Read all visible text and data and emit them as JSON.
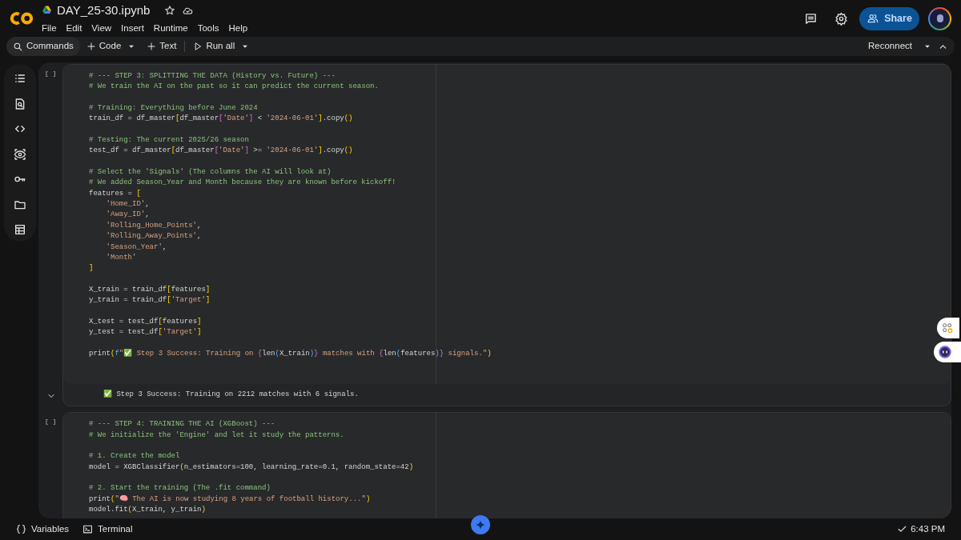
{
  "header": {
    "file_name": "DAY_25-30.ipynb",
    "menu": [
      "File",
      "Edit",
      "View",
      "Insert",
      "Runtime",
      "Tools",
      "Help"
    ],
    "share_label": "Share"
  },
  "toolbar": {
    "commands": "Commands",
    "add_code": "Code",
    "add_text": "Text",
    "run_all": "Run all",
    "connection": "Reconnect"
  },
  "cells": [
    {
      "run_label": "[ ]",
      "blocks": [
        [
          [
            {
              "kind": "comment",
              "text": "# --- STEP 3: SPLITTING THE DATA (History vs. Future) ---"
            }
          ],
          [
            {
              "kind": "comment",
              "text": "# We train the AI on the past so it can predict the current season."
            }
          ]
        ],
        [
          [
            {
              "kind": "comment",
              "text": "# Training: Everything before June 2024"
            }
          ],
          [
            {
              "kind": "plain",
              "text": "train_df = df_master"
            },
            {
              "kind": "bracket",
              "text": "["
            },
            {
              "kind": "plain",
              "text": "df_master"
            },
            {
              "kind": "brace",
              "text": "["
            },
            {
              "kind": "string",
              "text": "'Date'"
            },
            {
              "kind": "brace",
              "text": "]"
            },
            {
              "kind": "plain",
              "text": " < "
            },
            {
              "kind": "string",
              "text": "'2024-06-01'"
            },
            {
              "kind": "bracket",
              "text": "]"
            },
            {
              "kind": "plain",
              "text": ".copy"
            },
            {
              "kind": "bracket",
              "text": "()"
            }
          ]
        ],
        [
          [
            {
              "kind": "comment",
              "text": "# Testing: The current 2025/26 season"
            }
          ],
          [
            {
              "kind": "plain",
              "text": "test_df = df_master"
            },
            {
              "kind": "bracket",
              "text": "["
            },
            {
              "kind": "plain",
              "text": "df_master"
            },
            {
              "kind": "brace",
              "text": "["
            },
            {
              "kind": "string",
              "text": "'Date'"
            },
            {
              "kind": "brace",
              "text": "]"
            },
            {
              "kind": "plain",
              "text": " >= "
            },
            {
              "kind": "string",
              "text": "'2024-06-01'"
            },
            {
              "kind": "bracket",
              "text": "]"
            },
            {
              "kind": "plain",
              "text": ".copy"
            },
            {
              "kind": "bracket",
              "text": "()"
            }
          ]
        ],
        [
          [
            {
              "kind": "comment",
              "text": "# Select the 'Signals' (The columns the AI will look at)"
            }
          ],
          [
            {
              "kind": "comment",
              "text": "# We added Season_Year and Month because they are known before kickoff!"
            }
          ],
          [
            {
              "kind": "plain",
              "text": "features = "
            },
            {
              "kind": "bracket",
              "text": "["
            }
          ],
          [
            {
              "kind": "string",
              "text": "    'Home_ID'"
            },
            {
              "kind": "plain",
              "text": ","
            }
          ],
          [
            {
              "kind": "string",
              "text": "    'Away_ID'"
            },
            {
              "kind": "plain",
              "text": ","
            }
          ],
          [
            {
              "kind": "string",
              "text": "    'Rolling_Home_Points'"
            },
            {
              "kind": "plain",
              "text": ","
            }
          ],
          [
            {
              "kind": "string",
              "text": "    'Rolling_Away_Points'"
            },
            {
              "kind": "plain",
              "text": ","
            }
          ],
          [
            {
              "kind": "string",
              "text": "    'Season_Year'"
            },
            {
              "kind": "plain",
              "text": ","
            }
          ],
          [
            {
              "kind": "string",
              "text": "    'Month'"
            }
          ],
          [
            {
              "kind": "bracket",
              "text": "]"
            }
          ]
        ],
        [
          [
            {
              "kind": "plain",
              "text": "X_train = train_df"
            },
            {
              "kind": "bracket",
              "text": "["
            },
            {
              "kind": "plain",
              "text": "features"
            },
            {
              "kind": "bracket",
              "text": "]"
            }
          ],
          [
            {
              "kind": "plain",
              "text": "y_train = train_df"
            },
            {
              "kind": "bracket",
              "text": "["
            },
            {
              "kind": "string",
              "text": "'Target'"
            },
            {
              "kind": "bracket",
              "text": "]"
            }
          ]
        ],
        [
          [
            {
              "kind": "plain",
              "text": "X_test = test_df"
            },
            {
              "kind": "bracket",
              "text": "["
            },
            {
              "kind": "plain",
              "text": "features"
            },
            {
              "kind": "bracket",
              "text": "]"
            }
          ],
          [
            {
              "kind": "plain",
              "text": "y_test = test_df"
            },
            {
              "kind": "bracket",
              "text": "["
            },
            {
              "kind": "string",
              "text": "'Target'"
            },
            {
              "kind": "bracket",
              "text": "]"
            }
          ]
        ],
        [
          [
            {
              "kind": "plain",
              "text": "print"
            },
            {
              "kind": "bracket",
              "text": "("
            },
            {
              "kind": "paren",
              "text": "f"
            },
            {
              "kind": "string",
              "text": "\"✅ Step 3 Success: Training on "
            },
            {
              "kind": "brace",
              "text": "{"
            },
            {
              "kind": "plain",
              "text": "len"
            },
            {
              "kind": "paren",
              "text": "("
            },
            {
              "kind": "plain",
              "text": "X_train"
            },
            {
              "kind": "paren",
              "text": ")"
            },
            {
              "kind": "brace",
              "text": "}"
            },
            {
              "kind": "string",
              "text": " matches with "
            },
            {
              "kind": "brace",
              "text": "{"
            },
            {
              "kind": "plain",
              "text": "len"
            },
            {
              "kind": "paren",
              "text": "("
            },
            {
              "kind": "plain",
              "text": "features"
            },
            {
              "kind": "paren",
              "text": ")"
            },
            {
              "kind": "brace",
              "text": "}"
            },
            {
              "kind": "string",
              "text": " signals.\""
            },
            {
              "kind": "bracket",
              "text": ")"
            }
          ]
        ]
      ],
      "output": "✅ Step 3 Success: Training on 2212 matches with 6 signals."
    },
    {
      "run_label": "[ ]",
      "blocks": [
        [
          [
            {
              "kind": "comment",
              "text": "# --- STEP 4: TRAINING THE AI (XGBoost) ---"
            }
          ],
          [
            {
              "kind": "comment",
              "text": "# We initialize the 'Engine' and let it study the patterns."
            }
          ]
        ],
        [
          [
            {
              "kind": "comment",
              "text": "# 1. Create the model"
            }
          ],
          [
            {
              "kind": "plain",
              "text": "model = XGBClassifier"
            },
            {
              "kind": "bracket",
              "text": "("
            },
            {
              "kind": "plain",
              "text": "n_estimators=100, learning_rate=0.1, random_state=42"
            },
            {
              "kind": "bracket",
              "text": ")"
            }
          ]
        ],
        [
          [
            {
              "kind": "comment",
              "text": "# 2. Start the training (The .fit command)"
            }
          ],
          [
            {
              "kind": "plain",
              "text": "print"
            },
            {
              "kind": "bracket",
              "text": "("
            },
            {
              "kind": "string",
              "text": "\"🧠 The AI is now studying 8 years of football history...\""
            },
            {
              "kind": "bracket",
              "text": ")"
            }
          ],
          [
            {
              "kind": "plain",
              "text": "model.fit"
            },
            {
              "kind": "bracket",
              "text": "("
            },
            {
              "kind": "plain",
              "text": "X_train, y_train"
            },
            {
              "kind": "bracket",
              "text": ")"
            }
          ]
        ]
      ]
    }
  ],
  "bottom_bar": {
    "variables": "Variables",
    "terminal": "Terminal",
    "status": "6:43 PM"
  }
}
